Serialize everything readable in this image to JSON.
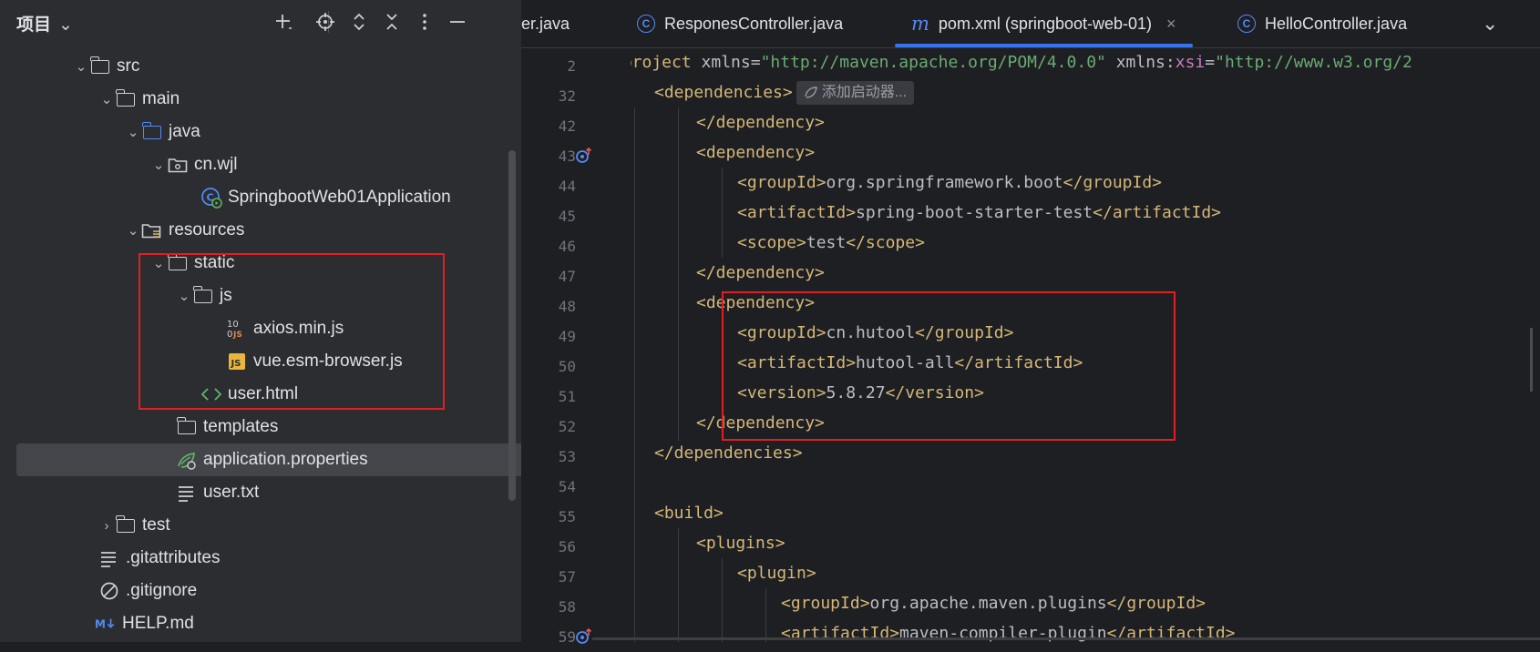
{
  "project_panel": {
    "title": "项目",
    "title_chevron": "⌄",
    "toolbar_icons": [
      "add-icon",
      "locate-icon",
      "expand-all-icon",
      "collapse-all-icon",
      "more-icon",
      "minimize-icon"
    ],
    "tree": [
      {
        "label": "src"
      },
      {
        "label": "main"
      },
      {
        "label": "java"
      },
      {
        "label": "cn.wjl"
      },
      {
        "label": "SpringbootWeb01Application"
      },
      {
        "label": "resources"
      },
      {
        "label": "static"
      },
      {
        "label": "js"
      },
      {
        "label": "axios.min.js"
      },
      {
        "label": "vue.esm-browser.js"
      },
      {
        "label": "user.html"
      },
      {
        "label": "templates"
      },
      {
        "label": "application.properties"
      },
      {
        "label": "user.txt"
      },
      {
        "label": "test"
      },
      {
        "label": ".gitattributes"
      },
      {
        "label": ".gitignore"
      },
      {
        "label": "HELP.md"
      }
    ]
  },
  "editor": {
    "tabs": [
      {
        "label": "er.java"
      },
      {
        "label": "ResponesController.java"
      },
      {
        "label": "pom.xml (springboot-web-01)",
        "icon": "m",
        "close": "×"
      },
      {
        "label": "HelloController.java"
      }
    ],
    "tabs_overflow": "⌄",
    "line_numbers": [
      "2",
      "32",
      "42",
      "43",
      "44",
      "45",
      "46",
      "47",
      "48",
      "49",
      "50",
      "51",
      "52",
      "53",
      "54",
      "55",
      "56",
      "57",
      "58",
      "59"
    ],
    "fold_hint": "添加启动器...",
    "code": {
      "l2_tag": "<project",
      "l2_attr1": " xmlns",
      "l2_eq1": "=",
      "l2_val1": "\"http://maven.apache.org/POM/4.0.0\"",
      "l2_attr2": " xmlns",
      "l2_colon": ":",
      "l2_ns": "xsi",
      "l2_eq2": "=",
      "l2_val2": "\"http://www.w3.org/2",
      "l32": "<dependencies>",
      "l42": "</dependency>",
      "l43": "<dependency>",
      "l44_open": "<groupId>",
      "l44_text": "org.springframework.boot",
      "l44_close": "</groupId>",
      "l45_open": "<artifactId>",
      "l45_text": "spring-boot-starter-test",
      "l45_close": "</artifactId>",
      "l46_open": "<scope>",
      "l46_text": "test",
      "l46_close": "</scope>",
      "l47": "</dependency>",
      "l48": "<dependency>",
      "l49_open": "<groupId>",
      "l49_text": "cn.hutool",
      "l49_close": "</groupId>",
      "l50_open": "<artifactId>",
      "l50_text": "hutool-all",
      "l50_close": "</artifactId>",
      "l51_open": "<version>",
      "l51_text": "5.8.27",
      "l51_close": "</version>",
      "l52": "</dependency>",
      "l53": "</dependencies>",
      "l55": "<build>",
      "l56": "<plugins>",
      "l57": "<plugin>",
      "l58_open": "<groupId>",
      "l58_text": "org.apache.maven.plugins",
      "l58_close": "</groupId>",
      "l59_open": "<artifactId>",
      "l59_text": "maven-compiler-plugin",
      "l59_close": "</artifactId>"
    }
  },
  "colors": {
    "tag": "#d5b778",
    "string": "#6aab73",
    "namespace": "#c77dbb",
    "accent": "#3574f0",
    "highlight_box": "#e02020"
  }
}
